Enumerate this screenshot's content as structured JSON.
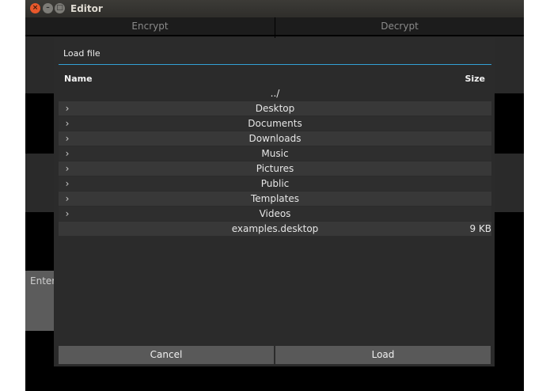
{
  "window": {
    "title": "Editor",
    "close_glyph": "×",
    "min_glyph": "–",
    "max_glyph": "□"
  },
  "app": {
    "encrypt_label": "Encrypt",
    "decrypt_label": "Decrypt",
    "enter_label": "Enter"
  },
  "dialog": {
    "title": "Load file",
    "columns": {
      "name": "Name",
      "size": "Size"
    },
    "parent_dir": "../",
    "entries": [
      {
        "name": "Desktop",
        "size": "",
        "is_dir": true
      },
      {
        "name": "Documents",
        "size": "",
        "is_dir": true
      },
      {
        "name": "Downloads",
        "size": "",
        "is_dir": true
      },
      {
        "name": "Music",
        "size": "",
        "is_dir": true
      },
      {
        "name": "Pictures",
        "size": "",
        "is_dir": true
      },
      {
        "name": "Public",
        "size": "",
        "is_dir": true
      },
      {
        "name": "Templates",
        "size": "",
        "is_dir": true
      },
      {
        "name": "Videos",
        "size": "",
        "is_dir": true
      },
      {
        "name": "examples.desktop",
        "size": "9 KB",
        "is_dir": false
      }
    ],
    "cancel_label": "Cancel",
    "load_label": "Load"
  },
  "colors": {
    "accent": "#33a1d6",
    "row_even": "#383838",
    "row_odd": "#2e2e2e"
  }
}
